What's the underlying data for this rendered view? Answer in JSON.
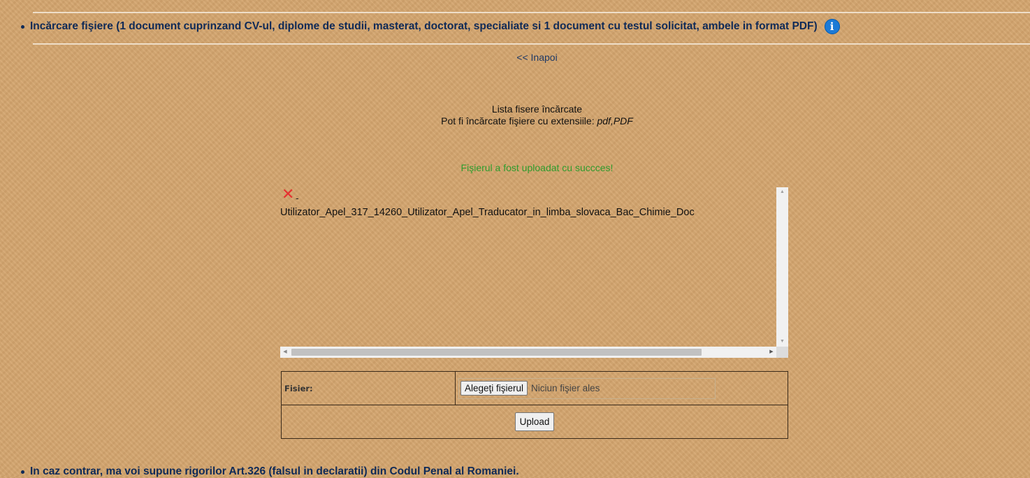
{
  "section": {
    "title": "Incărcare fişiere (1 document cuprinzand CV-ul, diplome de studii, masterat, doctorat, specialiate si 1 document cu testul solicitat, ambele in format PDF)",
    "info_icon": "info-icon"
  },
  "nav": {
    "back_label": "<< Inapoi"
  },
  "filelist": {
    "title": "Lista fisere încărcate",
    "extensions_prefix": "Pot fi încărcate fişiere cu extensiile: ",
    "extensions": "pdf,PDF",
    "success_message": "Fişierul a fost uploadat cu succces!",
    "files": [
      {
        "name": "Utilizator_Apel_317_14260_Utilizator_Apel_Traducator_in_limba_slovaca_Bac_Chimie_Doc",
        "separator": "-",
        "delete_icon": "delete-x-icon"
      }
    ]
  },
  "upload_form": {
    "file_label": "Fisier:",
    "choose_button": "Alegeţi fişierul",
    "no_file_text": "Niciun fişier ales",
    "upload_button": "Upload"
  },
  "footer": {
    "text": "In caz contrar, ma voi supune rigorilor Art.326 (falsul in declaratii) din Codul Penal al Romaniei."
  },
  "colors": {
    "background": "#d4a56e",
    "heading": "#0f2a57",
    "success": "#2e9c2e",
    "delete": "#e53030",
    "info": "#1c7ad6"
  }
}
